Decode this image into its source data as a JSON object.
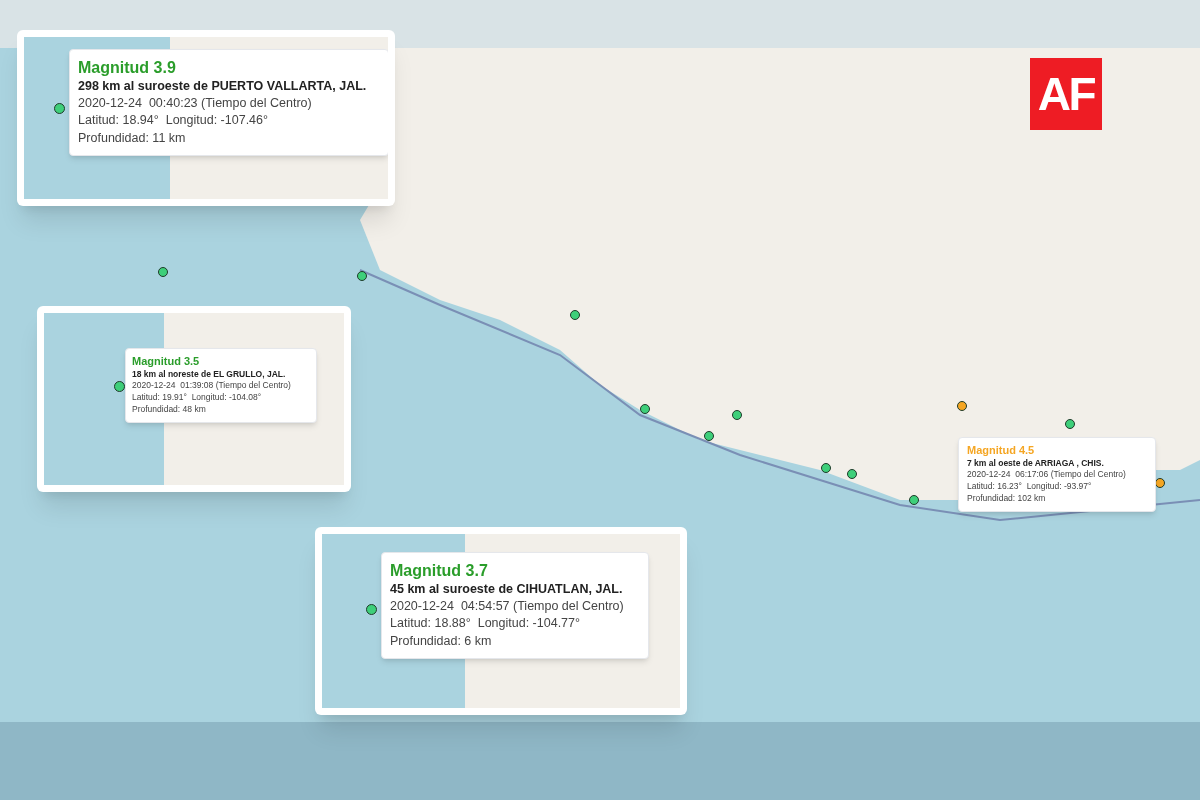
{
  "logo": {
    "text": "AF"
  },
  "markers": [
    {
      "color": "#3ecf7a"
    },
    {
      "color": "#3ecf7a"
    },
    {
      "color": "#3ecf7a"
    },
    {
      "color": "#3ecf7a"
    },
    {
      "color": "#3ecf7a"
    },
    {
      "color": "#3ecf7a"
    },
    {
      "color": "#3ecf7a"
    },
    {
      "color": "#3ecf7a"
    },
    {
      "color": "#3ecf7a"
    },
    {
      "color": "#f5a623"
    },
    {
      "color": "#3ecf7a"
    },
    {
      "color": "#f5a623"
    }
  ],
  "popups": [
    {
      "kind": "inset",
      "color": "#2a9d2a",
      "title": "Magnitud 3.9",
      "location": "298 km al suroeste de PUERTO VALLARTA, JAL.",
      "time": "2020-12-24  00:40:23 (Tiempo del Centro)",
      "coords": "Latitud: 18.94°  Longitud: -107.46°",
      "depth": "Profundidad: 11 km"
    },
    {
      "kind": "inset",
      "color": "#2a9d2a",
      "title": "Magnitud 3.5",
      "location": "18 km al noreste de EL GRULLO, JAL.",
      "time": "2020-12-24  01:39:08 (Tiempo del Centro)",
      "coords": "Latitud: 19.91°  Longitud: -104.08°",
      "depth": "Profundidad: 48 km"
    },
    {
      "kind": "inset",
      "color": "#2a9d2a",
      "title": "Magnitud 3.7",
      "location": "45 km al suroeste de CIHUATLAN, JAL.",
      "time": "2020-12-24  04:54:57 (Tiempo del Centro)",
      "coords": "Latitud: 18.88°  Longitud: -104.77°",
      "depth": "Profundidad: 6 km"
    },
    {
      "kind": "map",
      "color": "#f5a623",
      "title": "Magnitud 4.5",
      "location": "7 km al oeste de ARRIAGA , CHIS.",
      "time": "2020-12-24  06:17:06 (Tiempo del Centro)",
      "coords": "Latitud: 16.23°  Longitud: -93.97°",
      "depth": "Profundidad: 102 km"
    }
  ]
}
